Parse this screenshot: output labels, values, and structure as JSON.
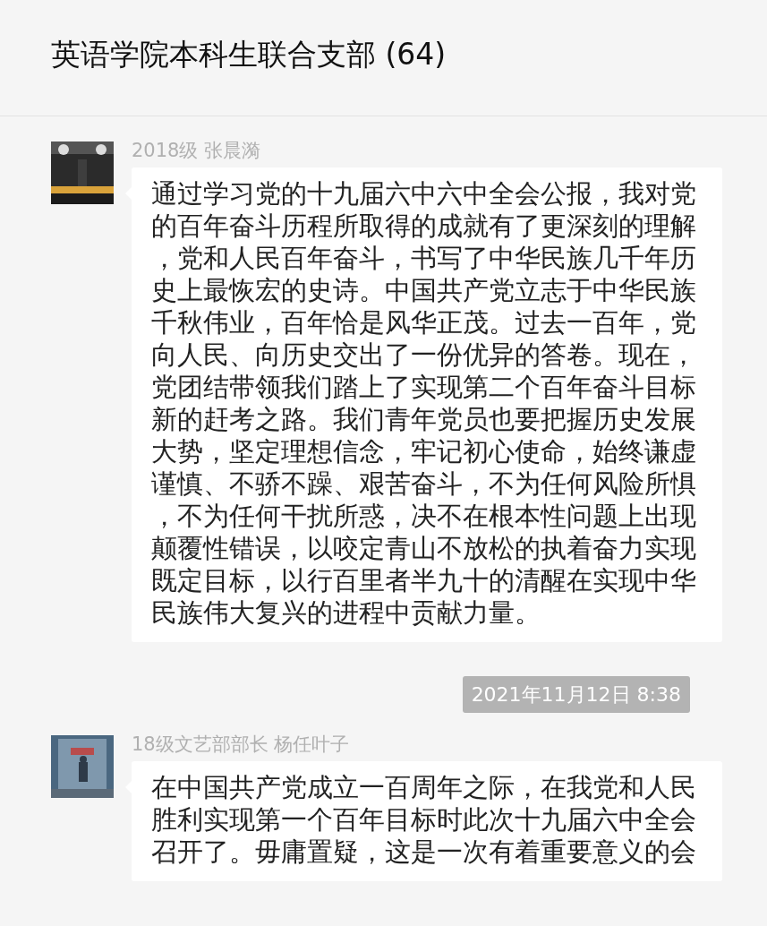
{
  "chat": {
    "title": "英语学院本科生联合支部 (64)"
  },
  "items": [
    {
      "kind": "message",
      "sender": "2018级 张晨漪",
      "text": "通过学习党的十九届六中六中全会公报，我对党的百年奋斗历程所取得的成就有了更深刻的理解，党和人民百年奋斗，书写了中华民族几千年历史上最恢宏的史诗。中国共产党立志于中华民族千秋伟业，百年恰是风华正茂。过去一百年，党向人民、向历史交出了一份优异的答卷。现在，党团结带领我们踏上了实现第二个百年奋斗目标新的赶考之路。我们青年党员也要把握历史发展大势，坚定理想信念，牢记初心使命，始终谦虚谨慎、不骄不躁、艰苦奋斗，不为任何风险所惧，不为任何干扰所惑，决不在根本性问题上出现颠覆性错误，以咬定青山不放松的执着奋力实现既定目标，以行百里者半九十的清醒在实现中华民族伟大复兴的进程中贡献力量。"
    },
    {
      "kind": "timestamp",
      "text": "2021年11月12日 8:38"
    },
    {
      "kind": "message",
      "sender": "18级文艺部部长 杨任叶子",
      "text": "在中国共产党成立一百周年之际，在我党和人民胜利实现第一个百年目标时此次十九届六中全会召开了。毋庸置疑，这是一次有着重要意义的会"
    }
  ]
}
